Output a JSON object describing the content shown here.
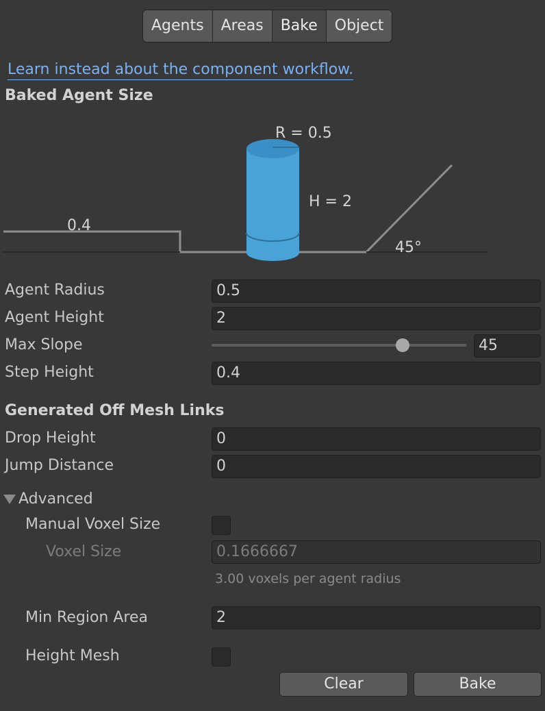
{
  "tabs": [
    "Agents",
    "Areas",
    "Bake",
    "Object"
  ],
  "active_tab": "Bake",
  "link_text": "Learn instead about the component workflow.",
  "baked_agent_size": {
    "header": "Baked Agent Size",
    "radius_label": "R = 0.5",
    "height_label": "H = 2",
    "step_label": "0.4",
    "slope_label": "45°",
    "cylinder_color": "#4aa3d6"
  },
  "fields": {
    "agent_radius": {
      "label": "Agent Radius",
      "value": "0.5"
    },
    "agent_height": {
      "label": "Agent Height",
      "value": "2"
    },
    "max_slope": {
      "label": "Max Slope",
      "value": "45",
      "slider_min": 0,
      "slider_max": 60
    },
    "step_height": {
      "label": "Step Height",
      "value": "0.4"
    }
  },
  "off_mesh": {
    "header": "Generated Off Mesh Links",
    "drop_height": {
      "label": "Drop Height",
      "value": "0"
    },
    "jump_distance": {
      "label": "Jump Distance",
      "value": "0"
    }
  },
  "advanced": {
    "label": "Advanced",
    "manual_voxel_size": {
      "label": "Manual Voxel Size",
      "checked": false
    },
    "voxel_size": {
      "label": "Voxel Size",
      "value": "0.1666667"
    },
    "voxel_hint": "3.00 voxels per agent radius",
    "min_region_area": {
      "label": "Min Region Area",
      "value": "2"
    },
    "height_mesh": {
      "label": "Height Mesh",
      "checked": false
    }
  },
  "buttons": {
    "clear": "Clear",
    "bake": "Bake"
  }
}
